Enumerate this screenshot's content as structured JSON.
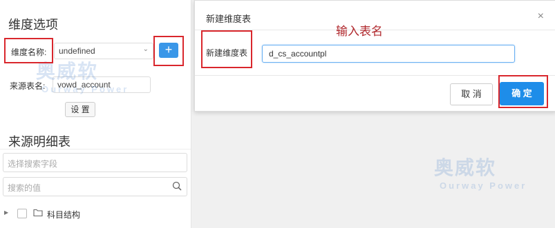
{
  "left": {
    "dimension_options_title": "维度选项",
    "dimension_name_label": "维度名称:",
    "dimension_select_value": "undefined",
    "add_label": "+",
    "source_table_label": "来源表名:",
    "source_table_value": "vowd_account",
    "settings_label": "设 置",
    "source_detail_title": "来源明细表",
    "field_search_placeholder": "选择搜索字段",
    "value_search_placeholder": "搜索的值",
    "tree_item_label": "科目结构"
  },
  "modal": {
    "title": "新建维度表",
    "annotation": "输入表名",
    "field_label": "新建维度表",
    "input_value": "d_cs_accountpl",
    "cancel_label": "取 消",
    "ok_label": "确 定",
    "close_symbol": "×"
  },
  "watermark": {
    "brand_cn": "奥威软",
    "brand_en": "Ourway Power"
  },
  "colors": {
    "primary": "#1e8de9",
    "highlight": "#d9262c",
    "annotation": "#b0282d"
  }
}
